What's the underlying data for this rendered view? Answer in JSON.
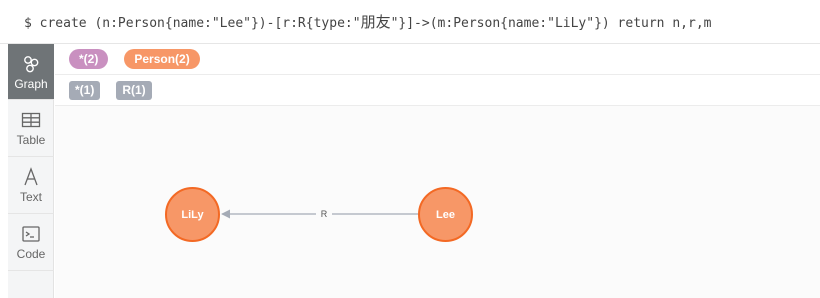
{
  "command": {
    "prompt": "$",
    "query_part1": "create (n:Person{name:\"Lee\"})-[r:R{type:\"",
    "query_cjk": "朋友",
    "query_part2": "\"}]->(m:Person{name:\"LiLy\"}) return n,r,m"
  },
  "sidebar": {
    "items": [
      {
        "label": "Graph",
        "icon": "graph-icon",
        "active": true
      },
      {
        "label": "Table",
        "icon": "table-icon",
        "active": false
      },
      {
        "label": "Text",
        "icon": "text-icon",
        "active": false
      },
      {
        "label": "Code",
        "icon": "code-icon",
        "active": false
      }
    ]
  },
  "legend": {
    "node_labels": [
      {
        "text": "*(2)",
        "color": "#c990c0"
      },
      {
        "text": "Person(2)",
        "color": "#f79767"
      }
    ],
    "relationship_types": [
      {
        "text": "*(1)",
        "color": "#a5abb6"
      },
      {
        "text": "R(1)",
        "color": "#a5abb6"
      }
    ]
  },
  "graph": {
    "node_color": "#f79767",
    "node_border": "#f36924",
    "edge_color": "#a5abb6",
    "nodes": [
      {
        "id": "m",
        "caption": "LiLy"
      },
      {
        "id": "n",
        "caption": "Lee"
      }
    ],
    "edge": {
      "from": "n",
      "to": "m",
      "label": "R"
    }
  }
}
